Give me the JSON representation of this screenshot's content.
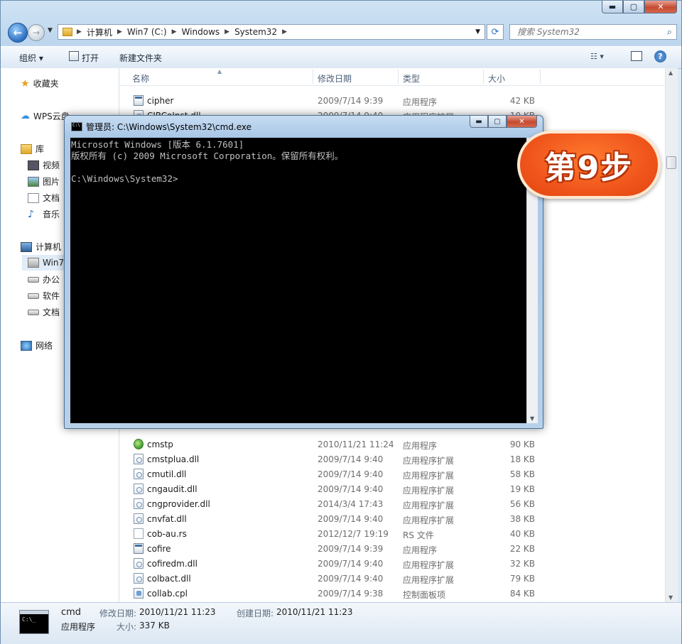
{
  "explorer": {
    "caption": {
      "minimize": "▬",
      "maximize": "▢",
      "close": "✕"
    },
    "address": {
      "crumbs": [
        "计算机",
        "Win7 (C:)",
        "Windows",
        "System32"
      ]
    },
    "search": {
      "placeholder": "搜索 System32"
    },
    "toolbar": {
      "organize": "组织 ▾",
      "open": "打开",
      "new_folder": "新建文件夹"
    },
    "nav": {
      "favorites": "收藏夹",
      "wps": "WPS云盘",
      "libraries": "库",
      "videos": "视频",
      "pictures": "图片",
      "documents": "文档",
      "music": "音乐",
      "computer": "计算机",
      "drive_c": "Win7",
      "drive_office": "办公",
      "drive_software": "软件",
      "drive_docs": "文档",
      "network": "网络"
    },
    "columns": {
      "name": "名称",
      "date": "修改日期",
      "type": "类型",
      "size": "大小"
    },
    "files": [
      {
        "name": "cipher",
        "date": "2009/7/14 9:39",
        "type": "应用程序",
        "size": "42 KB",
        "icon": "exe"
      },
      {
        "name": "CIRCoInst.dll",
        "date": "2009/7/14 9:40",
        "type": "应用程序扩展",
        "size": "10 KB",
        "icon": "dll"
      },
      {
        "name": "cmstp",
        "date": "2010/11/21 11:24",
        "type": "应用程序",
        "size": "90 KB",
        "icon": "green"
      },
      {
        "name": "cmstplua.dll",
        "date": "2009/7/14 9:40",
        "type": "应用程序扩展",
        "size": "18 KB",
        "icon": "dll"
      },
      {
        "name": "cmutil.dll",
        "date": "2009/7/14 9:40",
        "type": "应用程序扩展",
        "size": "58 KB",
        "icon": "dll"
      },
      {
        "name": "cngaudit.dll",
        "date": "2009/7/14 9:40",
        "type": "应用程序扩展",
        "size": "19 KB",
        "icon": "dll"
      },
      {
        "name": "cngprovider.dll",
        "date": "2014/3/4 17:43",
        "type": "应用程序扩展",
        "size": "56 KB",
        "icon": "dll"
      },
      {
        "name": "cnvfat.dll",
        "date": "2009/7/14 9:40",
        "type": "应用程序扩展",
        "size": "38 KB",
        "icon": "dll"
      },
      {
        "name": "cob-au.rs",
        "date": "2012/12/7 19:19",
        "type": "RS 文件",
        "size": "40 KB",
        "icon": "file"
      },
      {
        "name": "cofire",
        "date": "2009/7/14 9:39",
        "type": "应用程序",
        "size": "22 KB",
        "icon": "exe"
      },
      {
        "name": "cofiredm.dll",
        "date": "2009/7/14 9:40",
        "type": "应用程序扩展",
        "size": "32 KB",
        "icon": "dll"
      },
      {
        "name": "colbact.dll",
        "date": "2009/7/14 9:40",
        "type": "应用程序扩展",
        "size": "79 KB",
        "icon": "dll"
      },
      {
        "name": "collab.cpl",
        "date": "2009/7/14 9:38",
        "type": "控制面板项",
        "size": "84 KB",
        "icon": "cpl"
      }
    ],
    "details": {
      "name": "cmd",
      "type": "应用程序",
      "modified_label": "修改日期:",
      "modified": "2010/11/21 11:23",
      "created_label": "创建日期:",
      "created": "2010/11/21 11:23",
      "size_label": "大小:",
      "size": "337 KB",
      "thumb_text": "C:\\_"
    }
  },
  "cmd": {
    "title": "管理员: C:\\Windows\\System32\\cmd.exe",
    "caption": {
      "minimize": "▬",
      "maximize": "▢",
      "close": "✕"
    },
    "lines": [
      "Microsoft Windows [版本 6.1.7601]",
      "版权所有 (c) 2009 Microsoft Corporation。保留所有权利。",
      "",
      "C:\\Windows\\System32>"
    ]
  },
  "badge": {
    "text": "第9步"
  },
  "colors": {
    "badge": "#f0561c",
    "console_bg": "#000000",
    "console_fg": "#c0c0c0"
  }
}
